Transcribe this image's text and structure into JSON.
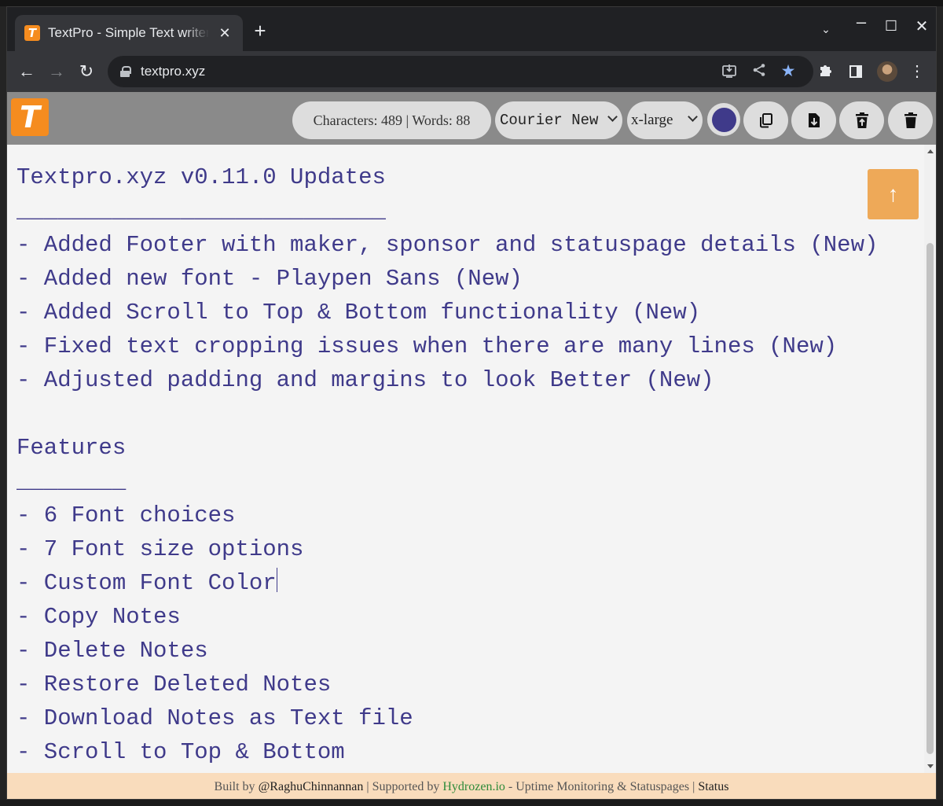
{
  "browser": {
    "tab_title": "TextPro - Simple Text writer",
    "tab_favicon_letter": "T",
    "tab_close": "✕",
    "new_tab": "+",
    "url": "textpro.xyz",
    "icons": [
      "back-arrow-icon",
      "forward-arrow-icon",
      "reload-icon",
      "lock-icon",
      "install-icon",
      "share-icon",
      "star-icon",
      "puzzle-icon",
      "side-panel-icon",
      "avatar",
      "kebab-menu-icon"
    ],
    "star_color": "#8ab4f8"
  },
  "app": {
    "logo_letter": "T",
    "brand_color": "#f58c1f",
    "counts": "Characters: 489 | Words: 88",
    "font_selected": "Courier New",
    "size_selected": "x-large",
    "font_color": "#3f3a8a",
    "toolbar_icons": [
      "copy-icon",
      "download-icon",
      "restore-icon",
      "trash-icon"
    ],
    "scroll_top_glyph": "↑"
  },
  "editor": {
    "lines_before_caret": "Textpro.xyz v0.11.0 Updates\n___________________________\n- Added Footer with maker, sponsor and statuspage details (New)\n- Added new font - Playpen Sans (New)\n- Added Scroll to Top & Bottom functionality (New)\n- Fixed text cropping issues when there are many lines (New)\n- Adjusted padding and margins to look Better (New)\n\nFeatures\n________\n- 6 Font choices\n- 7 Font size options\n- Custom Font Color",
    "lines_after_caret": "\n- Copy Notes\n- Delete Notes\n- Restore Deleted Notes\n- Download Notes as Text file\n- Scroll to Top & Bottom"
  },
  "footer": {
    "built_by": "Built by ",
    "maker": "@RaghuChinnannan",
    "sep1": " | Supported by ",
    "sponsor": "Hydrozen.io",
    "sponsor_desc": " - Uptime Monitoring & Statuspages | ",
    "status": "Status"
  }
}
